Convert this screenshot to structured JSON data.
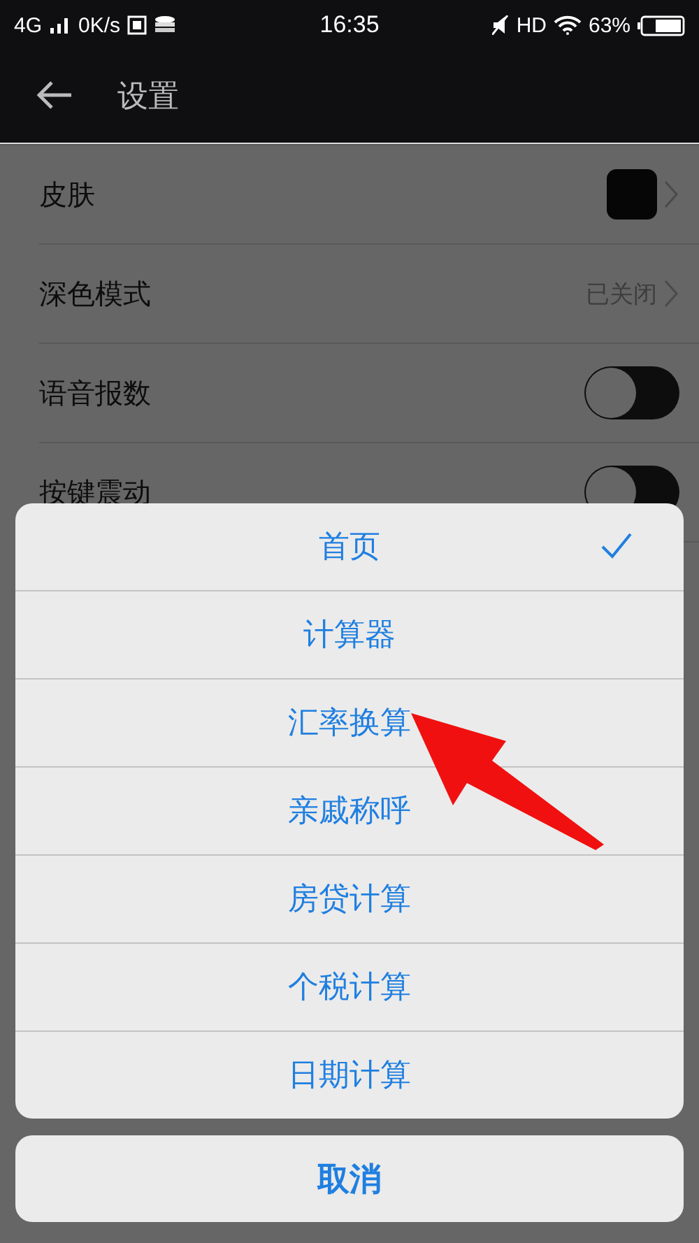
{
  "status_bar": {
    "network": "4G",
    "speed": "0K/s",
    "time": "16:35",
    "hd": "HD",
    "battery": "63%"
  },
  "header": {
    "title": "设置"
  },
  "settings": [
    {
      "label": "皮肤",
      "kind": "swatch"
    },
    {
      "label": "深色模式",
      "kind": "value",
      "value": "已关闭"
    },
    {
      "label": "语音报数",
      "kind": "toggle",
      "on": false
    },
    {
      "label": "按键震动",
      "kind": "toggle",
      "on": false
    }
  ],
  "action_sheet": {
    "options": [
      {
        "label": "首页",
        "selected": true
      },
      {
        "label": "计算器",
        "selected": false
      },
      {
        "label": "汇率换算",
        "selected": false
      },
      {
        "label": "亲戚称呼",
        "selected": false
      },
      {
        "label": "房贷计算",
        "selected": false
      },
      {
        "label": "个税计算",
        "selected": false
      },
      {
        "label": "日期计算",
        "selected": false
      }
    ],
    "cancel": "取消"
  }
}
